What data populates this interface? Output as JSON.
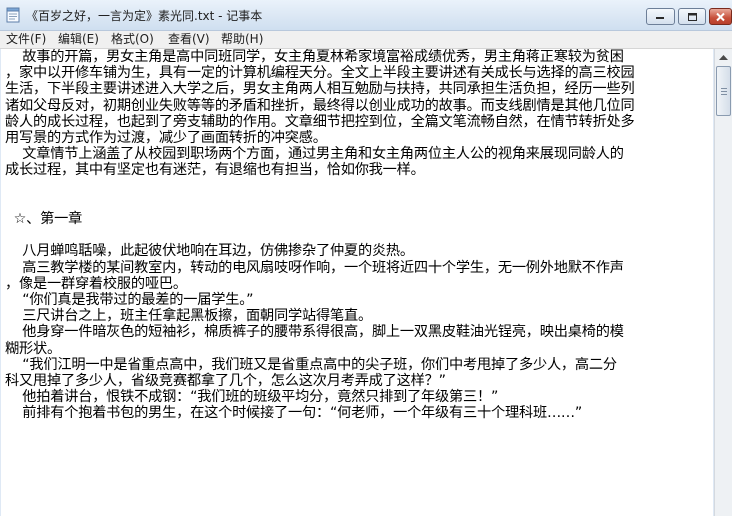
{
  "window": {
    "title": "《百岁之好，一言为定》素光同.txt - 记事本"
  },
  "menu": {
    "file": "文件(F)",
    "edit": "编辑(E)",
    "format": "格式(O)",
    "view": "查看(V)",
    "help": "帮助(H)"
  },
  "document": {
    "lines": [
      "    故事的开篇，男女主角是高中同班同学，女主角夏林希家境富裕成绩优秀，男主角蒋正寒较为贫困",
      "，家中以开修车铺为生，具有一定的计算机编程天分。全文上半段主要讲述有关成长与选择的高三校园",
      "生活，下半段主要讲述进入大学之后，男女主角两人相互勉励与扶持，共同承担生活负担，经历一些列",
      "诸如父母反对，初期创业失败等等的矛盾和挫折，最终得以创业成功的故事。而支线剧情是其他几位同",
      "龄人的成长过程，也起到了旁支辅助的作用。文章细节把控到位，全篇文笔流畅自然，在情节转折处多",
      "用写景的方式作为过渡，减少了画面转折的冲突感。",
      "    文章情节上涵盖了从校园到职场两个方面，通过男主角和女主角两位主人公的视角来展现同龄人的",
      "成长过程，其中有坚定也有迷茫，有退缩也有担当，恰如你我一样。",
      "",
      "",
      "  ☆、第一章",
      "",
      "    八月蝉鸣聒噪，此起彼伏地响在耳边，仿佛掺杂了仲夏的炎热。",
      "    高三教学楼的某间教室内，转动的电风扇吱呀作响，一个班将近四十个学生，无一例外地默不作声",
      "，像是一群穿着校服的哑巴。",
      "    “你们真是我带过的最差的一届学生。”",
      "    三尺讲台之上，班主任拿起黑板擦，面朝同学站得笔直。",
      "    他身穿一件暗灰色的短袖衫，棉质裤子的腰带系得很高，脚上一双黑皮鞋油光锃亮，映出桌椅的模",
      "糊形状。",
      "    “我们江明一中是省重点高中，我们班又是省重点高中的尖子班，你们中考甩掉了多少人，高二分",
      "科又甩掉了多少人，省级竞赛都拿了几个，怎么这次月考弄成了这样？”",
      "    他拍着讲台，恨铁不成钢：“我们班的班级平均分，竟然只排到了年级第三！”",
      "    前排有个抱着书包的男生，在这个时候接了一句：“何老师，一个年级有三十个理科班……”"
    ]
  },
  "icons": {
    "app": "notepad-icon",
    "minimize": "minimize-icon",
    "maximize": "maximize-icon",
    "close": "close-icon",
    "scroll_up": "chevron-up-icon"
  }
}
